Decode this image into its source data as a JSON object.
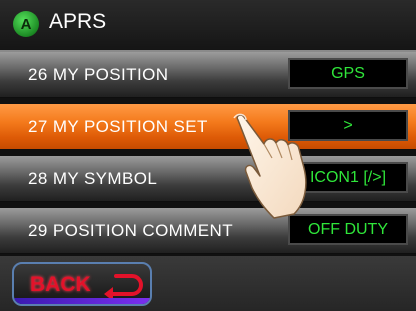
{
  "header": {
    "title": "APRS",
    "app_icon_letter": "A"
  },
  "menu": {
    "items": [
      {
        "number": "26",
        "label": "26  MY  POSITION",
        "value": "GPS",
        "selected": false
      },
      {
        "number": "27",
        "label": "27  MY  POSITION  SET",
        "value": ">",
        "selected": true
      },
      {
        "number": "28",
        "label": "28  MY  SYMBOL",
        "value": "ICON1 [/>]",
        "selected": false
      },
      {
        "number": "29",
        "label": "29  POSITION  COMMENT",
        "value": "OFF DUTY",
        "selected": false
      }
    ]
  },
  "footer": {
    "back_label": "BACK"
  },
  "colors": {
    "selected_row": "#f47a1c",
    "value_text": "#2fe63a",
    "back_text": "#e3122a"
  },
  "icons": {
    "app": "aprs-app-icon",
    "back": "return-arrow-icon",
    "pointer": "tapping-hand-icon"
  }
}
